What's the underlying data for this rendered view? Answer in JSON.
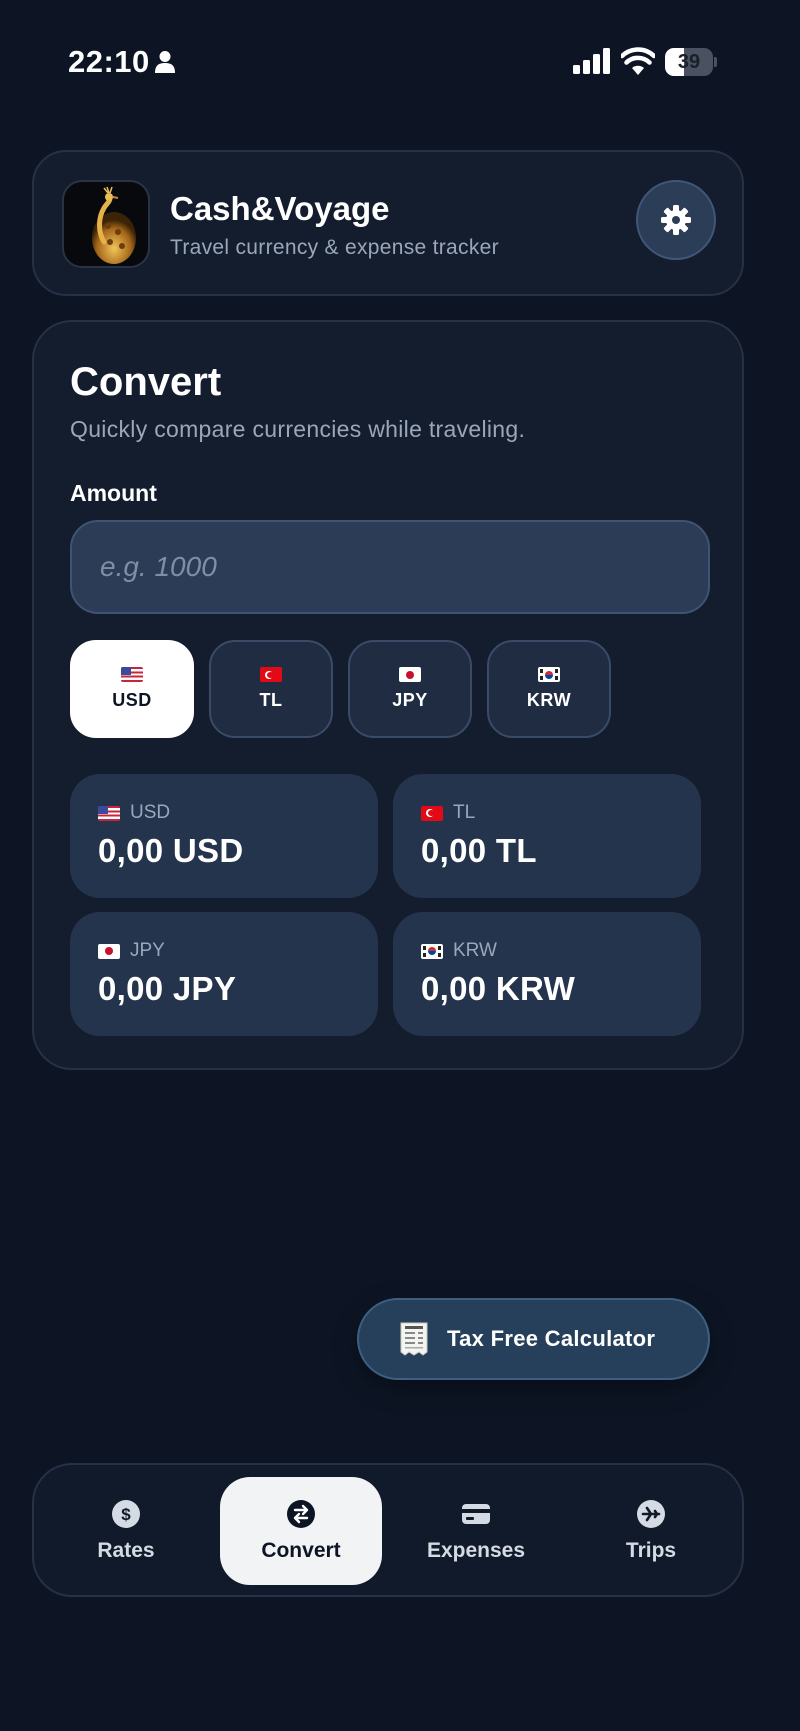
{
  "status_bar": {
    "time": "22:10",
    "battery_level": "39",
    "battery_fraction": 0.39,
    "icons": [
      "person-icon",
      "signal-icon",
      "wifi-icon",
      "battery-icon"
    ]
  },
  "header": {
    "app_name": "Cash&Voyage",
    "tagline": "Travel currency & expense tracker",
    "logo_icon": "peacock-logo",
    "settings_icon": "gear-icon"
  },
  "convert": {
    "title": "Convert",
    "subtitle": "Quickly compare currencies while traveling.",
    "amount_label": "Amount",
    "amount_value": "",
    "amount_placeholder": "e.g. 1000",
    "chips": [
      {
        "code": "USD",
        "flag": "us-flag",
        "selected": true
      },
      {
        "code": "TL",
        "flag": "tr-flag",
        "selected": false
      },
      {
        "code": "JPY",
        "flag": "jp-flag",
        "selected": false
      },
      {
        "code": "KRW",
        "flag": "kr-flag",
        "selected": false
      }
    ],
    "results": [
      {
        "code": "USD",
        "flag": "us-flag",
        "value": "0,00 USD"
      },
      {
        "code": "TL",
        "flag": "tr-flag",
        "value": "0,00 TL"
      },
      {
        "code": "JPY",
        "flag": "jp-flag",
        "value": "0,00 JPY"
      },
      {
        "code": "KRW",
        "flag": "kr-flag",
        "value": "0,00 KRW"
      }
    ]
  },
  "tax_free_button": {
    "label": "Tax Free Calculator",
    "icon": "receipt-icon"
  },
  "bottom_nav": {
    "items": [
      {
        "label": "Rates",
        "icon": "dollar-icon",
        "active": false
      },
      {
        "label": "Convert",
        "icon": "exchange-icon",
        "active": true
      },
      {
        "label": "Expenses",
        "icon": "card-icon",
        "active": false
      },
      {
        "label": "Trips",
        "icon": "plane-icon",
        "active": false
      }
    ]
  },
  "colors": {
    "background": "#0d1524",
    "card": "#141d2d",
    "tile": "#24344d",
    "accent_button": "#26405c",
    "active": "#ffffff"
  }
}
